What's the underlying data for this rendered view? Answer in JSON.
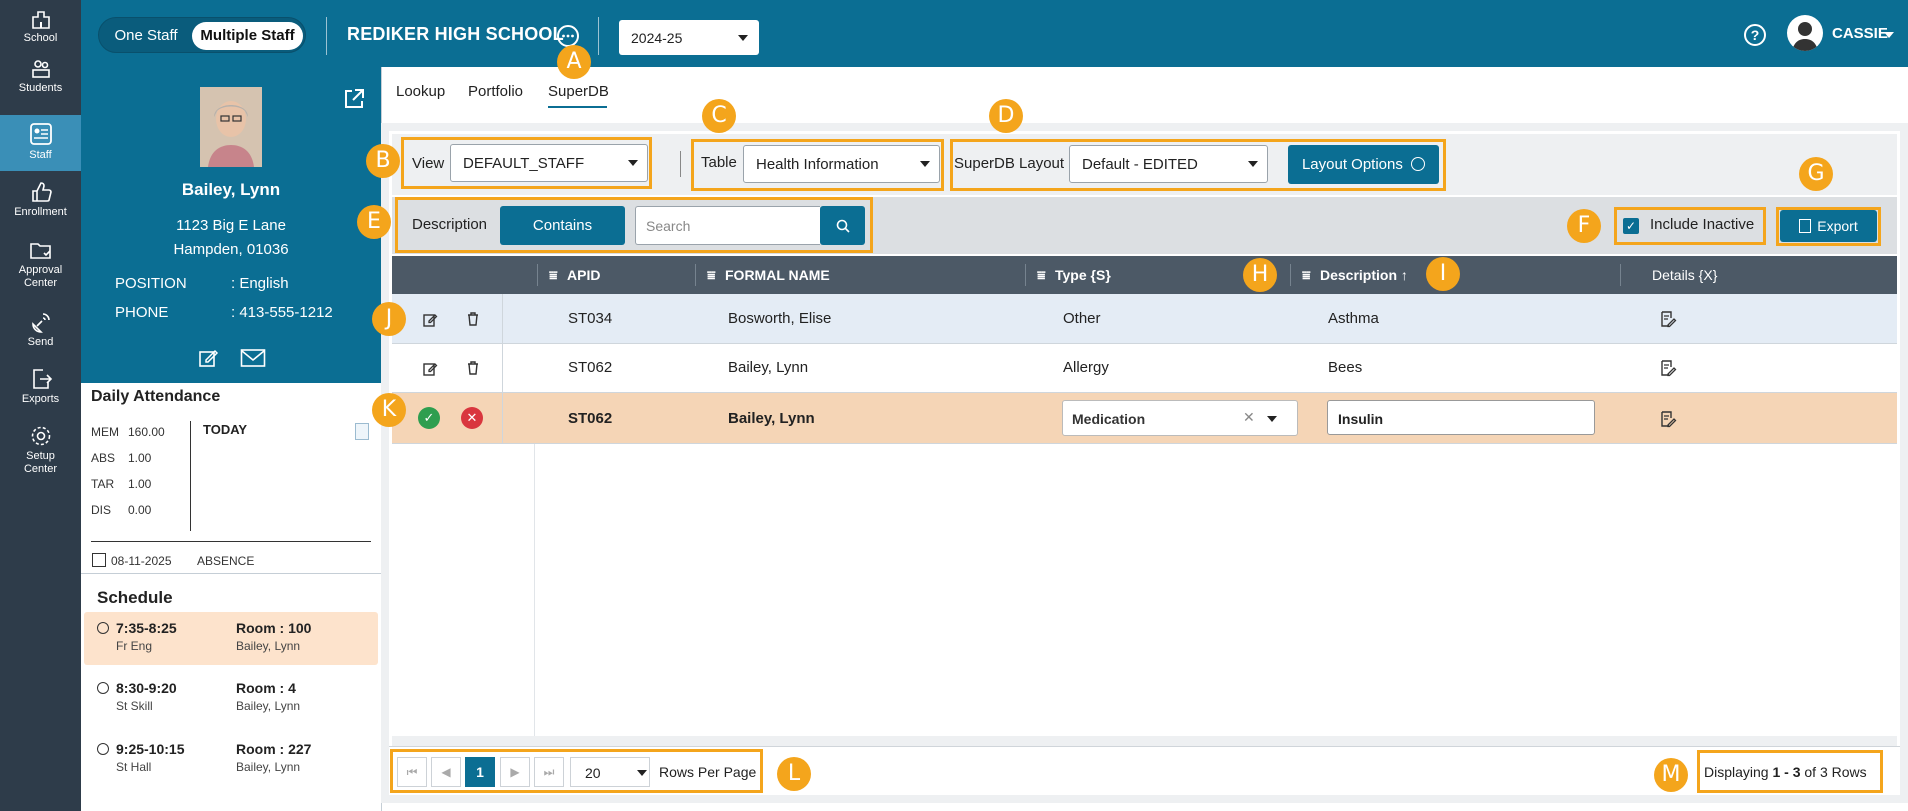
{
  "rail": {
    "items": [
      {
        "label": "School"
      },
      {
        "label": "Students"
      },
      {
        "label": "Staff"
      },
      {
        "label": "Enrollment"
      },
      {
        "label": "Approval",
        "label2": "Center"
      },
      {
        "label": "Send"
      },
      {
        "label": "Exports"
      },
      {
        "label": "Setup",
        "label2": "Center"
      }
    ]
  },
  "topbar": {
    "one_staff": "One Staff",
    "multiple_staff": "Multiple Staff",
    "school": "REDIKER HIGH SCHOOL",
    "year": "2024-25",
    "user": "CASSIE"
  },
  "staff": {
    "name": "Bailey, Lynn",
    "address1": "1123 Big E Lane",
    "address2": "Hampden, 01036",
    "position_label": "POSITION",
    "position_value": ": English",
    "phone_label": "PHONE",
    "phone_value": ": 413-555-1212"
  },
  "attendance": {
    "title": "Daily Attendance",
    "rows": [
      {
        "k": "MEM",
        "v": "160.00"
      },
      {
        "k": "ABS",
        "v": "1.00"
      },
      {
        "k": "TAR",
        "v": "1.00"
      },
      {
        "k": "DIS",
        "v": "0.00"
      }
    ],
    "today": "TODAY",
    "date": "08-11-2025",
    "status": "ABSENCE"
  },
  "schedule": {
    "title": "Schedule",
    "slots": [
      {
        "time": "7:35-8:25",
        "subj": "Fr Eng",
        "room": "Room : 100",
        "person": "Bailey, Lynn"
      },
      {
        "time": "8:30-9:20",
        "subj": "St Skill",
        "room": "Room : 4",
        "person": "Bailey, Lynn"
      },
      {
        "time": "9:25-10:15",
        "subj": "St Hall",
        "room": "Room : 227",
        "person": "Bailey, Lynn"
      }
    ]
  },
  "tabs": [
    "Lookup",
    "Portfolio",
    "SuperDB"
  ],
  "toolbar": {
    "view_label": "View",
    "view_value": "DEFAULT_STAFF",
    "table_label": "Table",
    "table_value": "Health Information",
    "layout_label": "SuperDB Layout",
    "layout_value": "Default - EDITED",
    "layout_options": "Layout Options"
  },
  "filter": {
    "field": "Description",
    "mode": "Contains",
    "search_placeholder": "Search",
    "include_inactive": "Include Inactive",
    "export": "Export"
  },
  "grid": {
    "columns": [
      "APID",
      "FORMAL NAME",
      "Type {S}",
      "Description ↑",
      "Details {X}"
    ],
    "rows": [
      {
        "apid": "ST034",
        "name": "Bosworth, Elise",
        "type": "Other",
        "desc": "Asthma"
      },
      {
        "apid": "ST062",
        "name": "Bailey, Lynn",
        "type": "Allergy",
        "desc": "Bees"
      },
      {
        "apid": "ST062",
        "name": "Bailey, Lynn",
        "type": "Medication",
        "desc": "Insulin"
      }
    ]
  },
  "pager": {
    "page": "1",
    "rows_per_page": "20",
    "rows_per_page_label": "Rows Per Page",
    "displaying_prefix": "Displaying",
    "displaying_range": "1 - 3",
    "displaying_suffix": "of 3 Rows"
  },
  "badges": [
    "A",
    "B",
    "C",
    "D",
    "E",
    "F",
    "G",
    "H",
    "I",
    "J",
    "K",
    "L",
    "M"
  ],
  "colors": {
    "brand": "#0b6e93",
    "rail": "#2e3c4a",
    "annotation": "#f4a51c",
    "highlight_row": "#f5d5b6"
  }
}
